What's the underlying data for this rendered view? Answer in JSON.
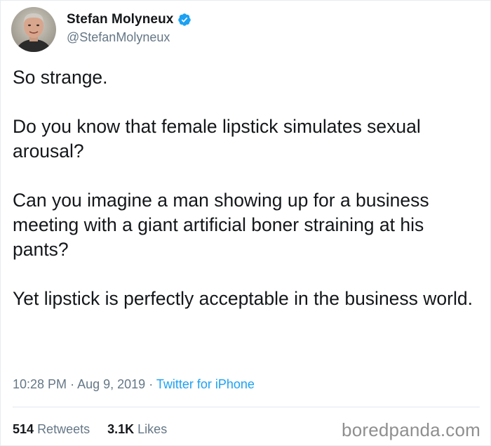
{
  "user": {
    "display_name": "Stefan Molyneux",
    "handle": "@StefanMolyneux",
    "verified_icon": "verified-badge-icon"
  },
  "tweet": {
    "paragraphs": [
      "So strange.",
      "Do you know that female lipstick simulates sexual arousal?",
      "Can you imagine a man showing up for a business meeting with a giant artificial boner straining at his pants?",
      "Yet lipstick is perfectly acceptable in the business world."
    ],
    "time": "10:28 PM",
    "date": "Aug 9, 2019",
    "source": "Twitter for iPhone",
    "separator": "·"
  },
  "stats": {
    "retweets_count": "514",
    "retweets_label": "Retweets",
    "likes_count": "3.1K",
    "likes_label": "Likes"
  },
  "watermark": "boredpanda.com",
  "colors": {
    "accent": "#1da1f2",
    "text": "#14171a",
    "secondary": "#657786"
  }
}
